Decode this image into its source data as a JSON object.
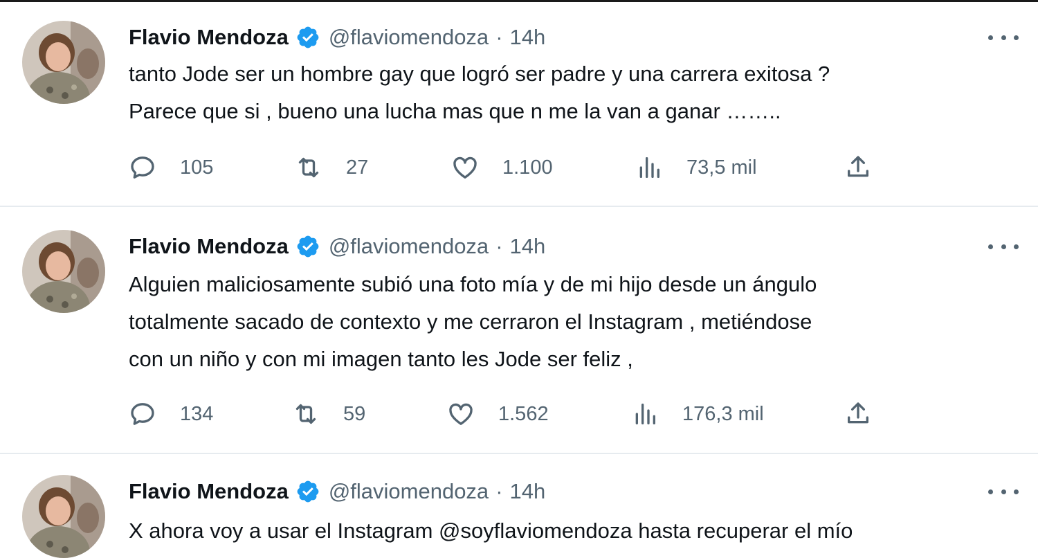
{
  "colors": {
    "verified": "#1d9bf0",
    "text": "#0f1419",
    "secondary": "#536471",
    "divider": "#e6ebef"
  },
  "tweets": [
    {
      "author": {
        "name": "Flavio Mendoza",
        "handle": "@flaviomendoza",
        "verified": true,
        "avatar_icon": "avatar-photo"
      },
      "separator": "·",
      "time": "14h",
      "lines": [
        "tanto Jode ser un hombre gay que logró ser padre y una carrera exitosa ?",
        "Parece que si , bueno una lucha mas que n me la van a ganar ……..",
        ""
      ],
      "stats": {
        "replies": "105",
        "retweets": "27",
        "likes": "1.100",
        "views": "73,5 mil"
      }
    },
    {
      "author": {
        "name": "Flavio Mendoza",
        "handle": "@flaviomendoza",
        "verified": true,
        "avatar_icon": "avatar-photo"
      },
      "separator": "·",
      "time": "14h",
      "lines": [
        "Alguien maliciosamente subió una foto mía y de mi hijo desde un ángulo",
        "totalmente sacado de contexto y me cerraron el Instagram , metiéndose",
        "con un niño y con mi imagen tanto les Jode ser feliz ,"
      ],
      "stats": {
        "replies": "134",
        "retweets": "59",
        "likes": "1.562",
        "views": "176,3 mil"
      }
    },
    {
      "author": {
        "name": "Flavio Mendoza",
        "handle": "@flaviomendoza",
        "verified": true,
        "avatar_icon": "avatar-photo"
      },
      "separator": "·",
      "time": "14h",
      "lines": [
        "X ahora voy a usar el Instagram @soyflaviomendoza hasta recuperar el mío",
        "",
        ""
      ]
    }
  ]
}
